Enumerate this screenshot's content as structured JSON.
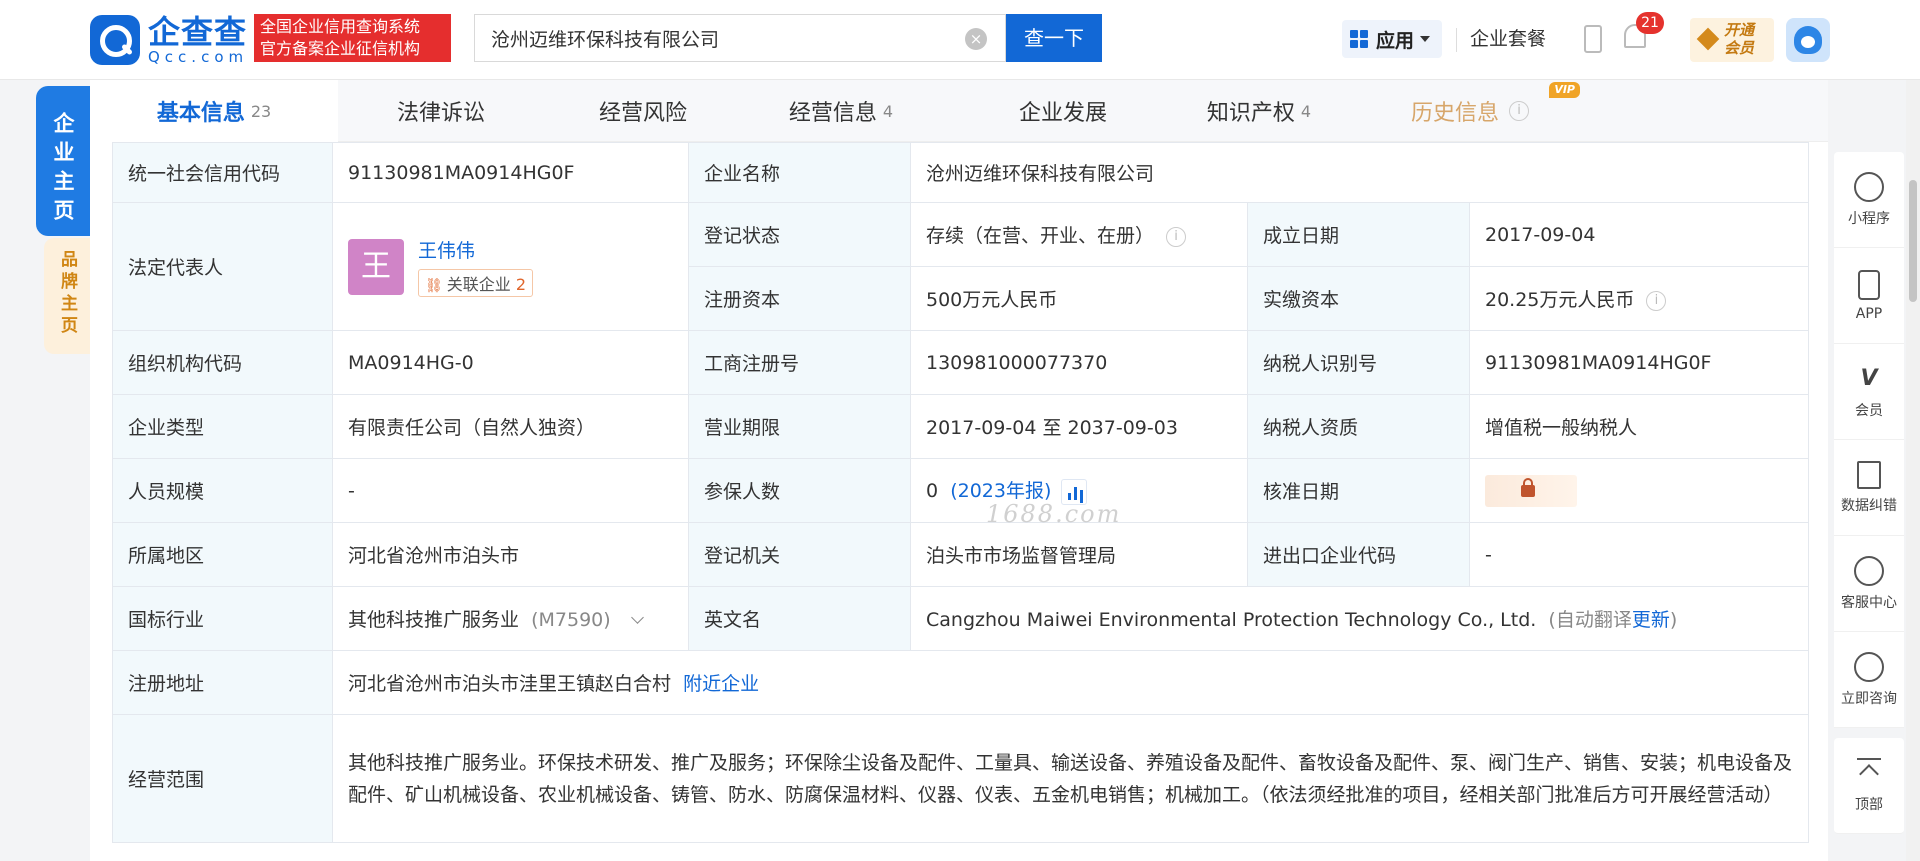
{
  "header": {
    "logo_cn": "企查查",
    "logo_en": "Qcc.com",
    "badge_line1": "全国企业信用查询系统",
    "badge_line2": "官方备案企业征信机构",
    "search_value": "沧州迈维环保科技有限公司",
    "search_button": "查一下",
    "apps_label": "应用",
    "package_label": "企业套餐",
    "notification_count": "21",
    "vip_line1": "开通",
    "vip_line2": "会员"
  },
  "side_tabs": {
    "main": "企业主页",
    "brand": "品牌主页"
  },
  "tabs": [
    {
      "label": "基本信息",
      "count": "23"
    },
    {
      "label": "法律诉讼",
      "count": ""
    },
    {
      "label": "经营风险",
      "count": ""
    },
    {
      "label": "经营信息",
      "count": "4"
    },
    {
      "label": "企业发展",
      "count": ""
    },
    {
      "label": "知识产权",
      "count": "4"
    },
    {
      "label": "历史信息",
      "count": "",
      "tag": "VIP"
    }
  ],
  "info": {
    "credit_code_label": "统一社会信用代码",
    "credit_code": "91130981MA0914HG0F",
    "company_name_label": "企业名称",
    "company_name": "沧州迈维环保科技有限公司",
    "legal_rep_label": "法定代表人",
    "legal_rep_avatar": "王",
    "legal_rep_name": "王伟伟",
    "related_label": "关联企业",
    "related_count": "2",
    "status_label": "登记状态",
    "status": "存续（在营、开业、在册）",
    "found_date_label": "成立日期",
    "found_date": "2017-09-04",
    "reg_capital_label": "注册资本",
    "reg_capital": "500万元人民币",
    "paid_capital_label": "实缴资本",
    "paid_capital": "20.25万元人民币",
    "org_code_label": "组织机构代码",
    "org_code": "MA0914HG-0",
    "biz_reg_no_label": "工商注册号",
    "biz_reg_no": "130981000077370",
    "taxpayer_id_label": "纳税人识别号",
    "taxpayer_id": "91130981MA0914HG0F",
    "company_type_label": "企业类型",
    "company_type": "有限责任公司（自然人独资）",
    "biz_term_label": "营业期限",
    "biz_term": "2017-09-04 至 2037-09-03",
    "tax_qual_label": "纳税人资质",
    "tax_qual": "增值税一般纳税人",
    "staff_size_label": "人员规模",
    "staff_size": "-",
    "insured_label": "参保人数",
    "insured": "0",
    "insured_year": "(2023年报)",
    "approve_date_label": "核准日期",
    "region_label": "所属地区",
    "region": "河北省沧州市泊头市",
    "reg_authority_label": "登记机关",
    "reg_authority": "泊头市市场监督管理局",
    "import_export_label": "进出口企业代码",
    "import_export": "-",
    "industry_label": "国标行业",
    "industry": "其他科技推广服务业",
    "industry_code": "(M7590)",
    "english_name_label": "英文名",
    "english_name": "Cangzhou Maiwei Environmental Protection Technology Co., Ltd.",
    "auto_translate": "(自动翻译",
    "update_link": "更新",
    "auto_translate_end": ")",
    "address_label": "注册地址",
    "address": "河北省沧州市泊头市洼里王镇赵白合村",
    "nearby_link": "附近企业",
    "scope_label": "经营范围",
    "scope": "其他科技推广服务业。环保技术研发、推广及服务；环保除尘设备及配件、工量具、输送设备、养殖设备及配件、畜牧设备及配件、泵、阀门生产、销售、安装；机电设备及配件、矿山机械设备、农业机械设备、铸管、防水、防腐保温材料、仪器、仪表、五金机电销售；机械加工。（依法须经批准的项目，经相关部门批准后方可开展经营活动）"
  },
  "watermark": "1688.com",
  "right_toolbar": [
    {
      "label": "小程序"
    },
    {
      "label": "APP"
    },
    {
      "label": "会员"
    },
    {
      "label": "数据纠错"
    },
    {
      "label": "客服中心"
    },
    {
      "label": "立即咨询"
    },
    {
      "label": "顶部"
    }
  ]
}
